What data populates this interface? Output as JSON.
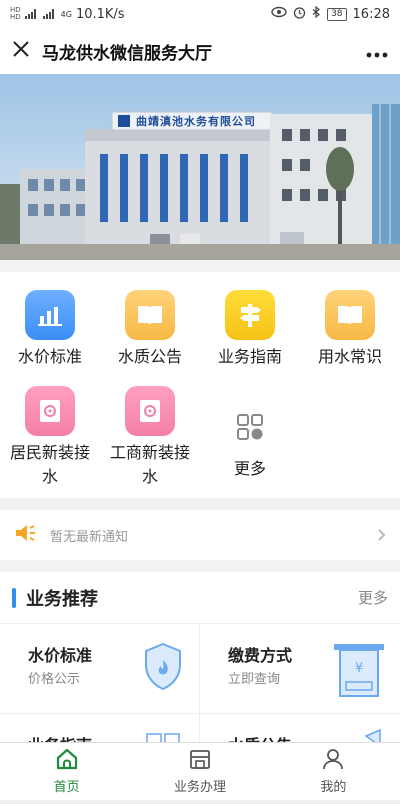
{
  "status_bar": {
    "sim1": "HD",
    "sim2": "HD",
    "net": "4G",
    "speed": "10.1K/s",
    "battery": "38",
    "time": "16:28"
  },
  "header": {
    "title": "马龙供水微信服务大厅"
  },
  "banner": {
    "sign_text": "曲靖滇池水务有限公司"
  },
  "grid": [
    {
      "label": "水价标准"
    },
    {
      "label": "水质公告"
    },
    {
      "label": "业务指南"
    },
    {
      "label": "用水常识"
    },
    {
      "label_line1": "居民新装接",
      "label_line2": "水"
    },
    {
      "label_line1": "工商新装接",
      "label_line2": "水"
    },
    {
      "label": "更多"
    }
  ],
  "notice": {
    "text": "暂无最新通知"
  },
  "recommend": {
    "title": "业务推荐",
    "more": "更多",
    "cards": [
      {
        "title": "水价标准",
        "subtitle": "价格公示"
      },
      {
        "title": "缴费方式",
        "subtitle": "立即查询"
      },
      {
        "title": "业务指南",
        "subtitle": ""
      },
      {
        "title": "水质公告",
        "subtitle": ""
      }
    ]
  },
  "tabs": [
    {
      "label": "首页",
      "active": true
    },
    {
      "label": "业务办理",
      "active": false
    },
    {
      "label": "我的",
      "active": false
    }
  ],
  "colors": {
    "accent": "#1e8a3a",
    "blue_icon": "#3a8ef6",
    "orange_icon": "#f7b944",
    "yellow_icon": "#f5c216",
    "pink_icon": "#f47fa8"
  }
}
